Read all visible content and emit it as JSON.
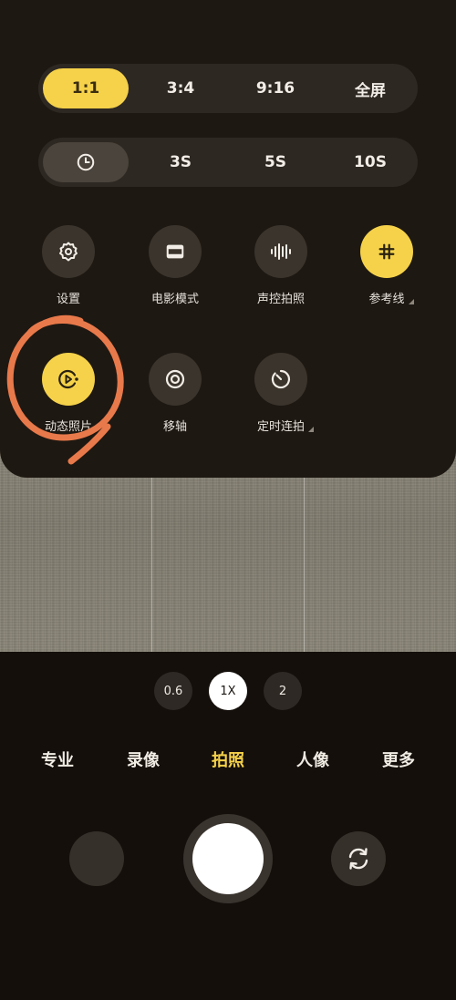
{
  "aspect_ratios": [
    {
      "label": "1:1",
      "active": true
    },
    {
      "label": "3:4"
    },
    {
      "label": "9:16"
    },
    {
      "label": "全屏"
    }
  ],
  "timer": {
    "icon": "clock-icon",
    "options": [
      {
        "label": "3S"
      },
      {
        "label": "5S"
      },
      {
        "label": "10S"
      }
    ]
  },
  "tiles_row1": [
    {
      "label": "设置",
      "icon": "gear-icon"
    },
    {
      "label": "电影模式",
      "icon": "film-icon"
    },
    {
      "label": "声控拍照",
      "icon": "soundwave-icon"
    },
    {
      "label": "参考线",
      "icon": "grid-icon",
      "active": true
    }
  ],
  "tiles_row2": [
    {
      "label": "动态照片",
      "icon": "live-photo-icon",
      "active": true
    },
    {
      "label": "移轴",
      "icon": "tilt-shift-icon"
    },
    {
      "label": "定时连拍",
      "icon": "timer-burst-icon"
    }
  ],
  "zoom": [
    {
      "label": "0.6"
    },
    {
      "label": "1X",
      "active": true
    },
    {
      "label": "2"
    }
  ],
  "modes": [
    {
      "label": "专业"
    },
    {
      "label": "录像"
    },
    {
      "label": "拍照",
      "active": true
    },
    {
      "label": "人像"
    },
    {
      "label": "更多"
    }
  ],
  "colors": {
    "accent": "#f5d24a",
    "annotation": "#e8794a",
    "panel": "#1e1812",
    "background": "#140f0b"
  }
}
